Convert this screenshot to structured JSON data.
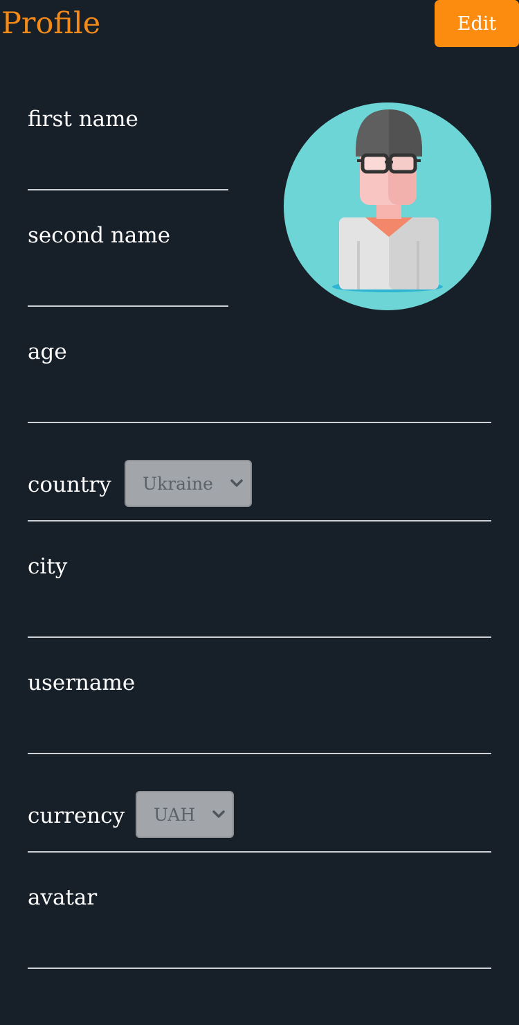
{
  "header": {
    "title": "Profile",
    "edit_label": "Edit"
  },
  "form": {
    "first_name": {
      "label": "first name",
      "value": ""
    },
    "second_name": {
      "label": "second name",
      "value": ""
    },
    "age": {
      "label": "age",
      "value": ""
    },
    "country": {
      "label": "country",
      "selected": "Ukraine"
    },
    "city": {
      "label": "city",
      "value": ""
    },
    "username": {
      "label": "username",
      "value": ""
    },
    "currency": {
      "label": "currency",
      "selected": "UAH"
    },
    "avatar": {
      "label": "avatar",
      "value": ""
    }
  },
  "colors": {
    "background": "#171f29",
    "accent": "#fb8c0f",
    "title": "#f48a17"
  },
  "icons": {
    "avatar": "user-avatar-icon",
    "select_arrow": "chevron-down-icon"
  }
}
